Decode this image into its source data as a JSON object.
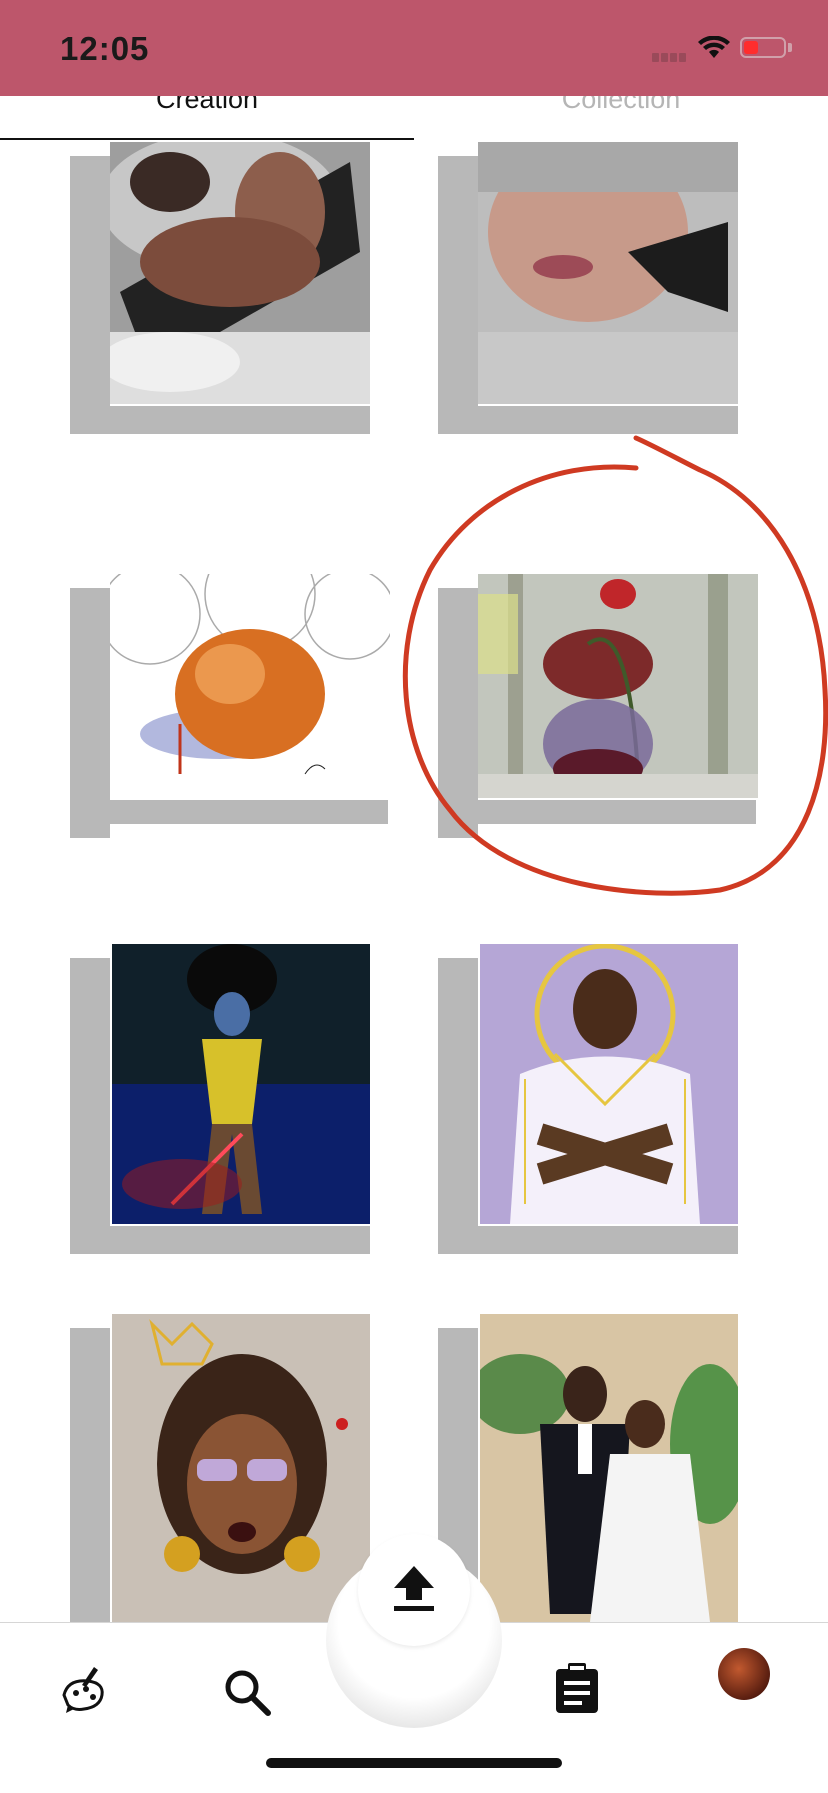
{
  "status_bar": {
    "time": "12:05",
    "background": "#bd566b"
  },
  "tabs": [
    {
      "label": "Creation",
      "selected": true
    },
    {
      "label": "Collection",
      "selected": false
    }
  ],
  "artworks": [
    {
      "name": "portrait-woman-fur",
      "palette": "gray"
    },
    {
      "name": "portrait-woman-lips",
      "palette": "gray"
    },
    {
      "name": "peach-sketch",
      "palette": "orange"
    },
    {
      "name": "roses-in-vase",
      "palette": "purple",
      "highlighted": true
    },
    {
      "name": "woman-yellow-sword",
      "palette": "dark-blue"
    },
    {
      "name": "man-white-halo",
      "palette": "lavender"
    },
    {
      "name": "woman-braids-sunglasses",
      "palette": "warm"
    },
    {
      "name": "wedding-couple",
      "palette": "green"
    }
  ],
  "annotation": {
    "shape": "freehand-circle",
    "color": "#cf3a22"
  },
  "bottom_bar": {
    "items": [
      {
        "icon": "palette-icon"
      },
      {
        "icon": "search-icon"
      },
      {
        "icon": "upload-icon"
      },
      {
        "icon": "clipboard-icon"
      },
      {
        "icon": "avatar"
      }
    ]
  }
}
